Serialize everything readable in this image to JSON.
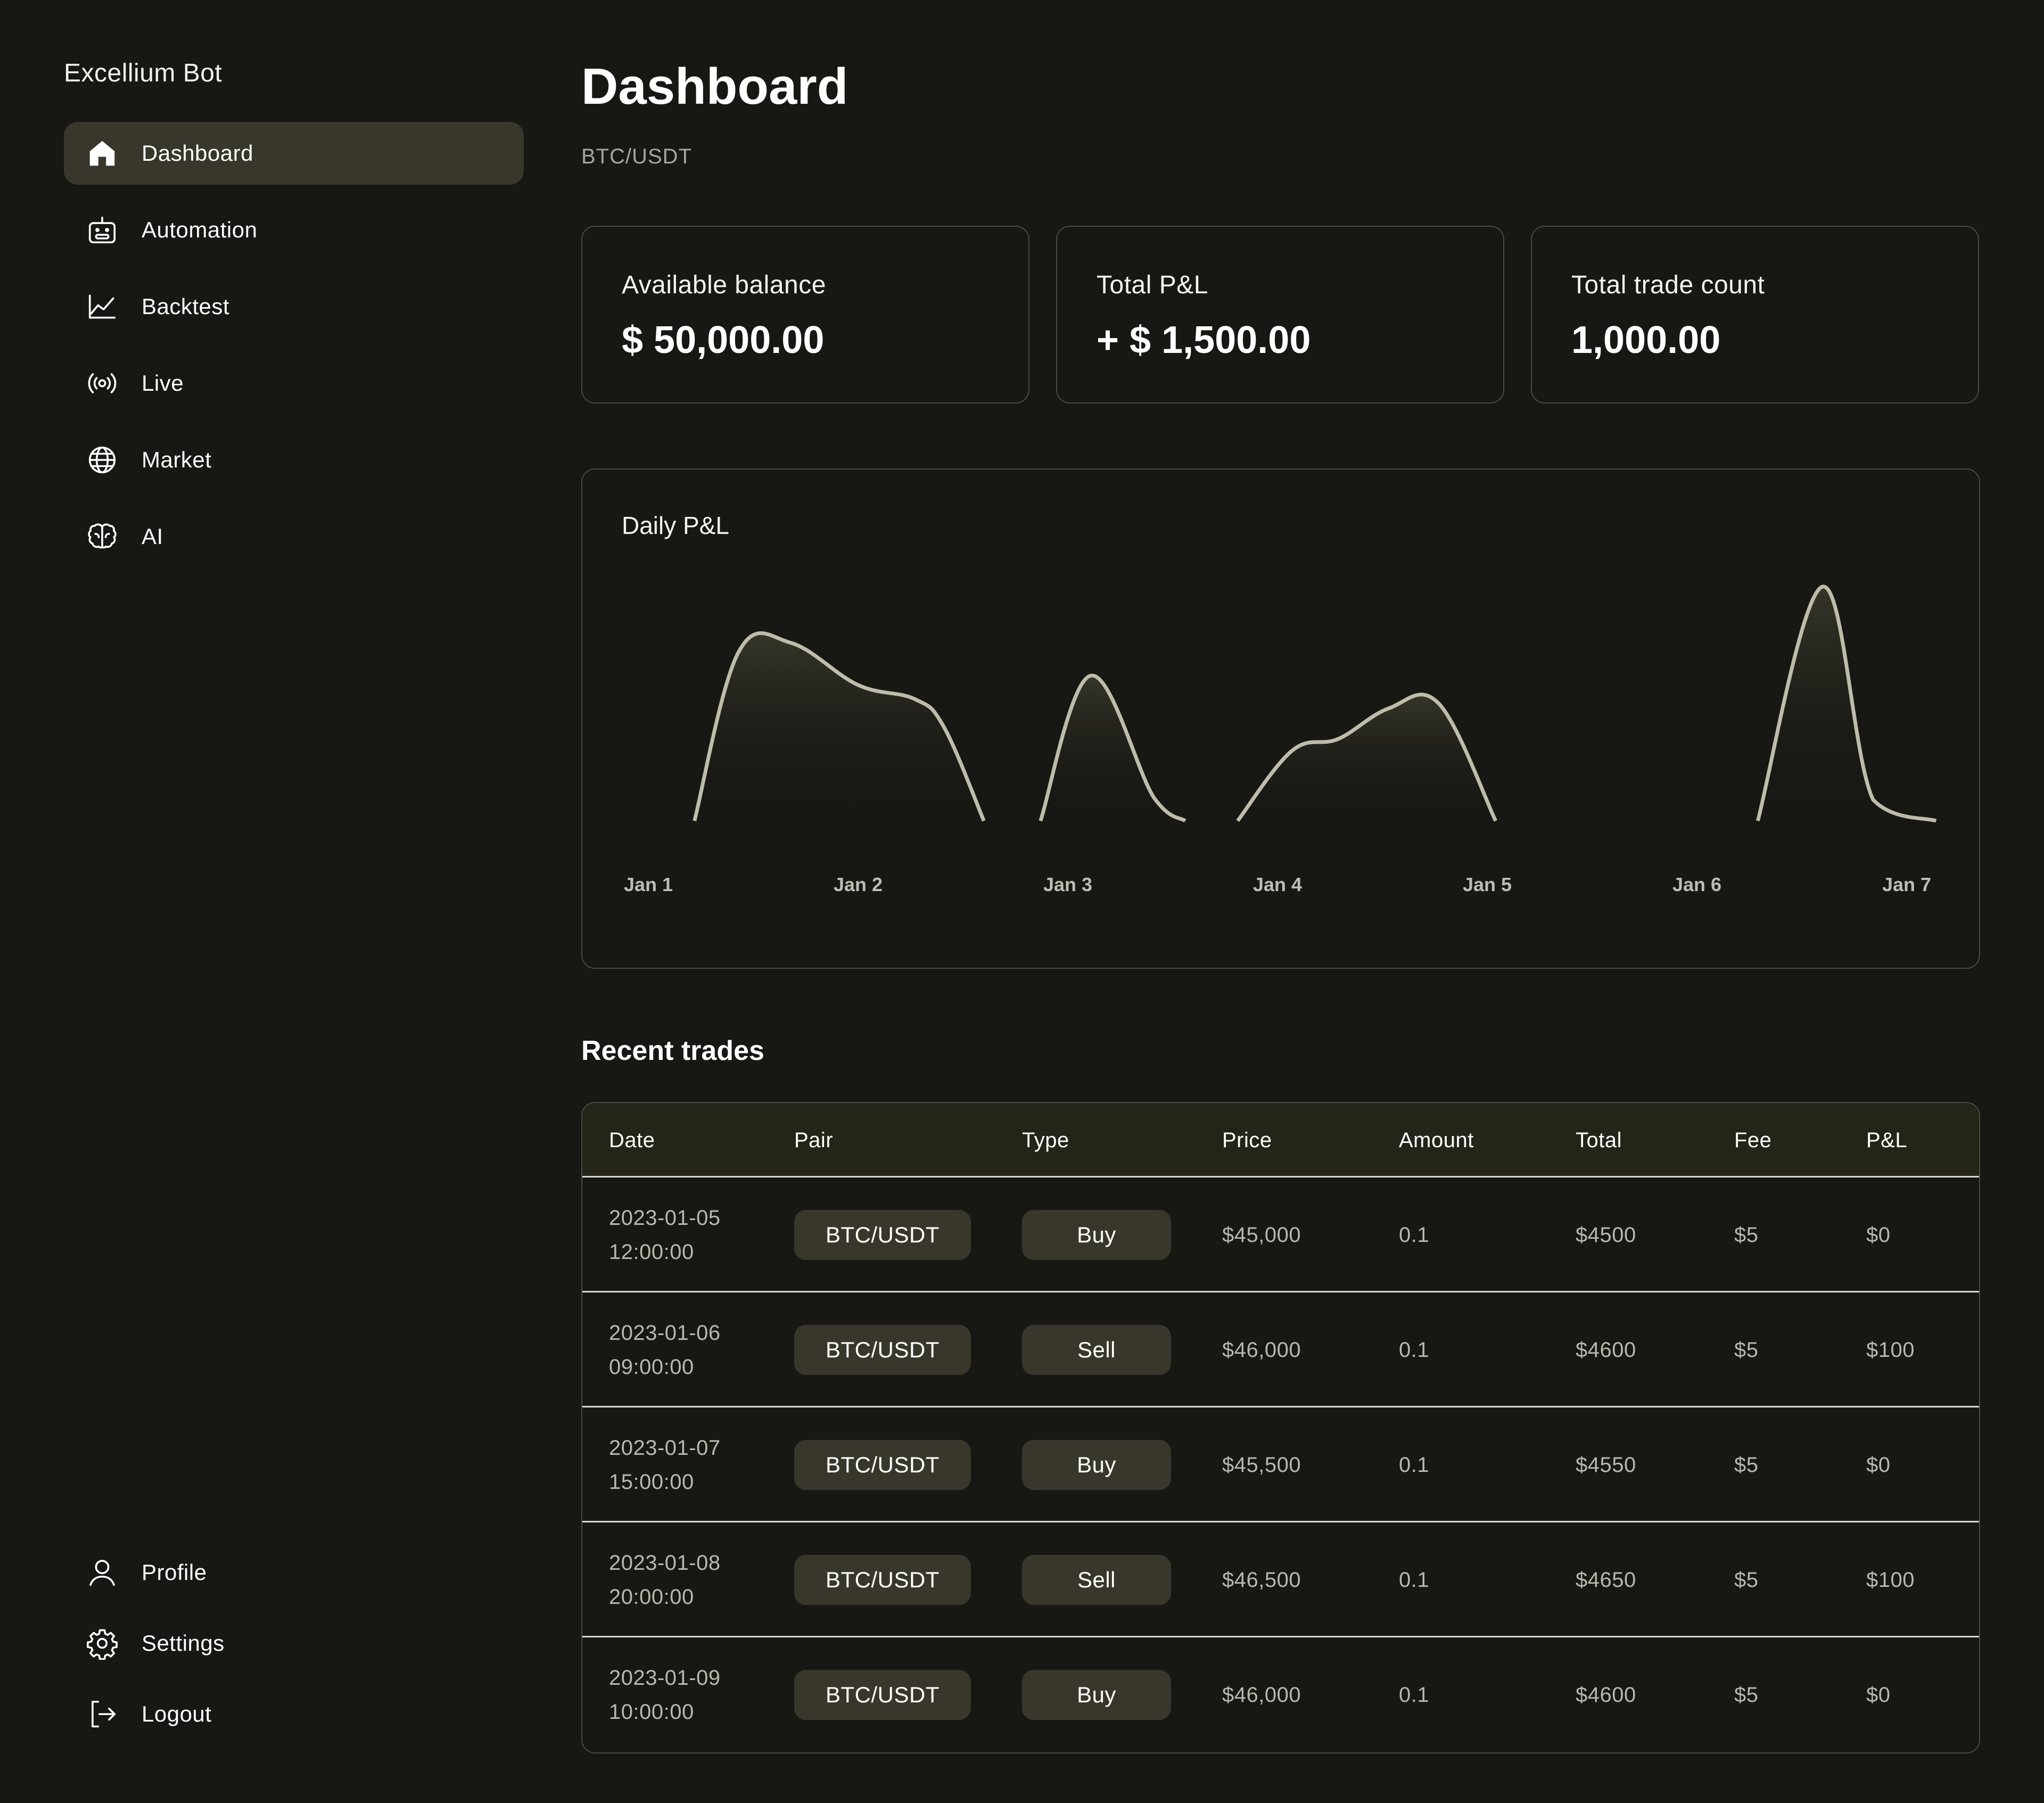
{
  "app": {
    "title": "Excellium Bot"
  },
  "sidebar": {
    "items": [
      {
        "label": "Dashboard",
        "icon": "home-icon",
        "active": true
      },
      {
        "label": "Automation",
        "icon": "robot-icon",
        "active": false
      },
      {
        "label": "Backtest",
        "icon": "line-chart-icon",
        "active": false
      },
      {
        "label": "Live",
        "icon": "broadcast-icon",
        "active": false
      },
      {
        "label": "Market",
        "icon": "globe-icon",
        "active": false
      },
      {
        "label": "AI",
        "icon": "brain-icon",
        "active": false
      }
    ],
    "bottom_items": [
      {
        "label": "Profile",
        "icon": "user-icon"
      },
      {
        "label": "Settings",
        "icon": "gear-icon"
      },
      {
        "label": "Logout",
        "icon": "logout-icon"
      }
    ]
  },
  "header": {
    "title": "Dashboard",
    "subtitle": "BTC/USDT"
  },
  "stats": [
    {
      "label": "Available balance",
      "value": "$ 50,000.00"
    },
    {
      "label": "Total P&L",
      "value": "+ $ 1,500.00"
    },
    {
      "label": "Total trade count",
      "value": "1,000.00"
    }
  ],
  "chart_data": {
    "type": "area",
    "title": "Daily P&L",
    "categories": [
      "Jan 1",
      "Jan 2",
      "Jan 3",
      "Jan 4",
      "Jan 5",
      "Jan 6",
      "Jan 7"
    ],
    "series": [
      {
        "x": [
          0.22,
          0.43,
          0.68,
          1.0,
          1.27,
          1.41,
          1.6,
          1.87,
          2.11,
          2.41,
          2.56,
          2.81,
          3.07,
          3.29,
          3.53,
          3.77,
          4.04,
          4.3,
          4.47,
          4.66,
          4.86,
          5.12,
          5.29,
          5.6,
          5.84,
          6.14,
          6.33
        ],
        "values": [
          0,
          0.72,
          0.76,
          0.58,
          0.52,
          0.4,
          0,
          0,
          0.62,
          0.1,
          0,
          0,
          0.3,
          0.35,
          0.48,
          0.5,
          0,
          0,
          0,
          0,
          0,
          0,
          0,
          1.0,
          0.09,
          0,
          0
        ],
        "color": "#bfbca9"
      }
    ],
    "grid": false,
    "legend": "none",
    "colors": {
      "line": "#c9c6b2",
      "fill_top": "#3a382c"
    }
  },
  "recent_trades": {
    "title": "Recent trades",
    "columns": [
      "Date",
      "Pair",
      "Type",
      "Price",
      "Amount",
      "Total",
      "Fee",
      "P&L"
    ],
    "rows": [
      {
        "date": "2023-01-05\n12:00:00",
        "pair": "BTC/USDT",
        "type": "Buy",
        "price": "$45,000",
        "amount": "0.1",
        "total": "$4500",
        "fee": "$5",
        "pnl": "$0"
      },
      {
        "date": "2023-01-06\n09:00:00",
        "pair": "BTC/USDT",
        "type": "Sell",
        "price": "$46,000",
        "amount": "0.1",
        "total": "$4600",
        "fee": "$5",
        "pnl": "$100"
      },
      {
        "date": "2023-01-07\n15:00:00",
        "pair": "BTC/USDT",
        "type": "Buy",
        "price": "$45,500",
        "amount": "0.1",
        "total": "$4550",
        "fee": "$5",
        "pnl": "$0"
      },
      {
        "date": "2023-01-08\n20:00:00",
        "pair": "BTC/USDT",
        "type": "Sell",
        "price": "$46,500",
        "amount": "0.1",
        "total": "$4650",
        "fee": "$5",
        "pnl": "$100"
      },
      {
        "date": "2023-01-09\n10:00:00",
        "pair": "BTC/USDT",
        "type": "Buy",
        "price": "$46,000",
        "amount": "0.1",
        "total": "$4600",
        "fee": "$5",
        "pnl": "$0"
      }
    ]
  }
}
